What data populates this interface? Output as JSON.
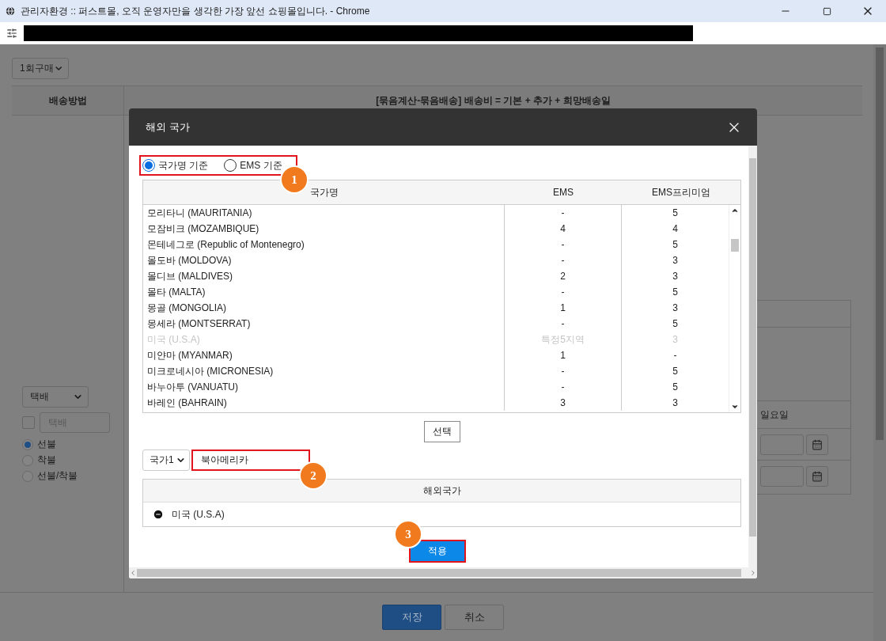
{
  "window": {
    "title": "관리자환경 :: 퍼스트몰, 오직 운영자만을 생각한 가장 앞선 쇼핑몰입니다. - Chrome"
  },
  "page": {
    "purchase_select": "1회구매",
    "method_header": "배송방법",
    "formula_header": "[묶음계산-묶음배송] 배송비 = 기본 + 추가 + 희망배송일",
    "shipping_select": "택배",
    "custom_method": {
      "checked": false,
      "placeholder": "택배"
    },
    "payment_options": [
      {
        "label": "선불",
        "selected": true
      },
      {
        "label": "착불",
        "selected": false
      },
      {
        "label": "선불/착불",
        "selected": false
      }
    ],
    "weekday": "일요일",
    "buttons": [
      {
        "label": "저장",
        "kind": "primary"
      },
      {
        "label": "취소",
        "kind": "secondary"
      }
    ]
  },
  "dialog": {
    "title": "해외 국가",
    "sort_options": [
      {
        "label": "국가명 기준",
        "selected": true
      },
      {
        "label": "EMS 기준",
        "selected": false
      }
    ],
    "columns": [
      "국가명",
      "EMS",
      "EMS프리미엄"
    ],
    "rows": [
      {
        "name": "모리타니 (MAURITANIA)",
        "ems": "-",
        "premium": "5",
        "disabled": false
      },
      {
        "name": "모잠비크 (MOZAMBIQUE)",
        "ems": "4",
        "premium": "4",
        "disabled": false
      },
      {
        "name": "몬테네그로 (Republic of Montenegro)",
        "ems": "-",
        "premium": "5",
        "disabled": false
      },
      {
        "name": "몰도바 (MOLDOVA)",
        "ems": "-",
        "premium": "3",
        "disabled": false
      },
      {
        "name": "몰디브 (MALDIVES)",
        "ems": "2",
        "premium": "3",
        "disabled": false
      },
      {
        "name": "몰타 (MALTA)",
        "ems": "-",
        "premium": "5",
        "disabled": false
      },
      {
        "name": "몽골 (MONGOLIA)",
        "ems": "1",
        "premium": "3",
        "disabled": false
      },
      {
        "name": "몽세라 (MONTSERRAT)",
        "ems": "-",
        "premium": "5",
        "disabled": false
      },
      {
        "name": "미국 (U.S.A)",
        "ems": "특정5지역",
        "premium": "3",
        "disabled": true
      },
      {
        "name": "미얀마 (MYANMAR)",
        "ems": "1",
        "premium": "-",
        "disabled": false
      },
      {
        "name": "미크로네시아 (MICRONESIA)",
        "ems": "-",
        "premium": "5",
        "disabled": false
      },
      {
        "name": "바누아투 (VANUATU)",
        "ems": "-",
        "premium": "5",
        "disabled": false
      },
      {
        "name": "바레인 (BAHRAIN)",
        "ems": "3",
        "premium": "3",
        "disabled": false
      }
    ],
    "select_button": "선택",
    "group_select": "국가1",
    "group_name": "북아메리카",
    "selected_header": "해외국가",
    "selected_countries": [
      "미국 (U.S.A)"
    ],
    "apply_button": "적용"
  },
  "annotations": [
    "1",
    "2",
    "3"
  ]
}
